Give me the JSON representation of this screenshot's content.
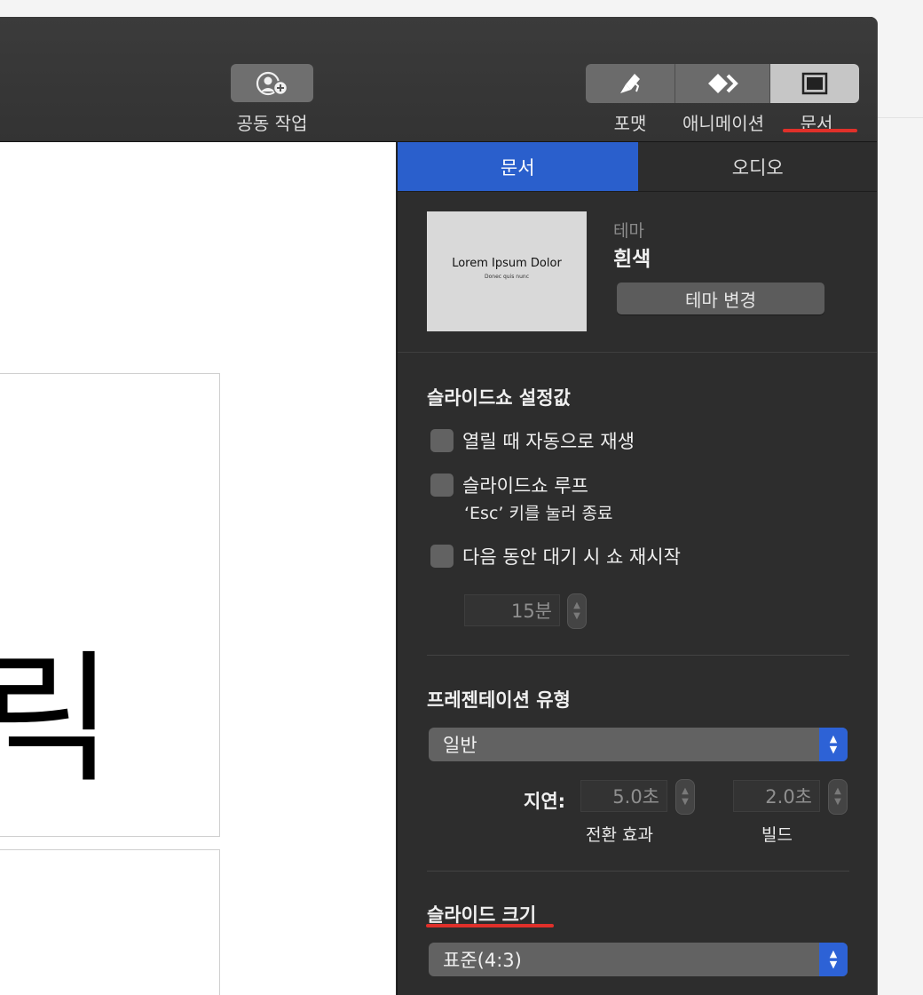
{
  "toolbar": {
    "collab_label": "공동 작업",
    "format_label": "포맷",
    "animate_label": "애니메이션",
    "document_label": "문서"
  },
  "inspector": {
    "tabs": [
      "문서",
      "오디오"
    ],
    "theme": {
      "label": "테마",
      "name": "흰색",
      "change_button": "테마 변경",
      "thumb_title": "Lorem Ipsum Dolor",
      "thumb_subtitle": "Donec quis nunc"
    },
    "slideshow": {
      "heading": "슬라이드쇼 설정값",
      "autoplay": "열릴 때 자동으로 재생",
      "loop": "슬라이드쇼 루프",
      "loop_hint": "‘Esc’ 키를 눌러 종료",
      "restart": "다음 동안 대기 시 쇼 재시작",
      "restart_value": "15분"
    },
    "presentation": {
      "heading": "프레젠테이션 유형",
      "type_value": "일반",
      "delay_label": "지연:",
      "transition_value": "5.0초",
      "build_value": "2.0초",
      "transition_label": "전환 효과",
      "build_label": "빌드"
    },
    "slide_size": {
      "heading": "슬라이드 크기",
      "value": "표준(4:3)"
    }
  },
  "canvas": {
    "glyph": "릭"
  },
  "colors": {
    "accent_blue": "#2a5fcc",
    "highlight_red": "#e0302a"
  }
}
